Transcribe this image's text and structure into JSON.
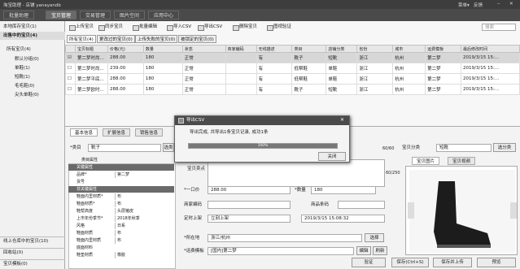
{
  "app": {
    "title": "淘宝助理 - 店铺 yanayandb",
    "menu": "菜单▾",
    "feedback": "反馈",
    "min": "‒",
    "close": "✕"
  },
  "nav": {
    "tabs": [
      "批量助理",
      "宝贝管理",
      "交易管理",
      "图片空间",
      "应用中心"
    ],
    "active": 1
  },
  "sidebar": {
    "top_items": [
      "本地库存宝贝(1)",
      "出售中的宝贝(4)"
    ],
    "tree": [
      {
        "label": "所有宝贝(4)"
      },
      {
        "label": "默认分组(0)"
      },
      {
        "label": "单鞋(1)"
      },
      {
        "label": "短靴(1)"
      },
      {
        "label": "毛毛鞋(0)"
      },
      {
        "label": "尖头单鞋(0)"
      }
    ],
    "bottom_items": [
      "线上仓库中的宝贝(10)",
      "回收站(0)",
      "宝贝模板(0)"
    ]
  },
  "toolbar": {
    "buttons": [
      "上传宝贝",
      "同步宝贝",
      "批量编辑",
      "导入CSV",
      "导出CSV",
      "删除宝贝",
      "图视验证"
    ],
    "search_placeholder": "搜索"
  },
  "filter_tabs": [
    "所有宝贝(4)",
    "更改过的宝贝(0)",
    "上传失败的宝贝(0)",
    "被锁定的宝贝(0)"
  ],
  "grid": {
    "headers": [
      "宝贝标题",
      "价格(元)",
      "数量",
      "状态",
      "商家编码",
      "无线描述",
      "类目",
      "店铺分类",
      "省份",
      "城市",
      "运费模板",
      "最后修改时间"
    ],
    "rows": [
      [
        "第二梦时尚...",
        "288.00",
        "180",
        "正常",
        "",
        "有",
        "靴子",
        "短靴",
        "浙江",
        "杭州",
        "第二梦",
        "2019/3/15 15:..."
      ],
      [
        "第二梦时尚...",
        "239.00",
        "180",
        "正常",
        "",
        "有",
        "低帮鞋",
        "单鞋",
        "浙江",
        "杭州",
        "第二梦",
        "2019/3/15 15:..."
      ],
      [
        "第二梦平底...",
        "288.00",
        "180",
        "正常",
        "",
        "有",
        "低帮鞋",
        "单鞋",
        "浙江",
        "杭州",
        "第二梦",
        "2019/3/15 15:..."
      ],
      [
        "第二梦欧时...",
        "288.00",
        "180",
        "正常",
        "",
        "有",
        "靴子",
        "短靴",
        "浙江",
        "杭州",
        "第二梦",
        "2019/3/15 15:..."
      ]
    ]
  },
  "detail": {
    "tabs": [
      "基本信息",
      "扩展信息",
      "销售信息"
    ],
    "category_label": "*类目",
    "category_value": "靴子",
    "category_btn": "选类",
    "props_header": "类目属性",
    "props": [
      [
        "关键属性",
        ""
      ],
      [
        "品牌*",
        "第二梦"
      ],
      [
        "货号",
        ""
      ],
      [
        "非关键属性",
        ""
      ],
      [
        "鞋面内里材质*",
        "布"
      ],
      [
        "鞋面材质*",
        "布"
      ],
      [
        "鞋帮高度",
        "头层猪皮"
      ],
      [
        "上市年份季节*",
        "2018年秋季"
      ],
      [
        "风格",
        "日系"
      ],
      [
        "鞋面材质",
        "布"
      ],
      [
        "鞋面内里材质",
        "布"
      ],
      [
        "底面材料",
        ""
      ],
      [
        "鞋垫材质",
        "橡胶"
      ]
    ],
    "title_label": "宝贝卖点",
    "counter": "60/250",
    "price_label": "*一口价",
    "price_value": "288.00",
    "qty_label": "*数量",
    "qty_value": "180",
    "code_label": "商家编码",
    "barcode_label": "商品条码",
    "onsale_label": "定时上架",
    "onsale_value": "立刻上架",
    "onsale_time": "2019/3/15 15:08:32",
    "location_label": "*所在地",
    "location_value": "浙江/杭州",
    "location_btn": "选择",
    "shipping_label": "*运费模板",
    "shipping_value": "[国内]第二梦",
    "shipping_btn1": "编辑",
    "shipping_btn2": "刷新",
    "shop_cat_label": "宝贝分类",
    "shop_cat_value": "短靴",
    "shop_cat_btn": "选分类",
    "title_counter": "60/60",
    "img_tabs": [
      "宝贝图片",
      "宝贝视频"
    ]
  },
  "footer": {
    "buttons": [
      "验证",
      "保存(Ctrl+S)",
      "保存并上传",
      "预览"
    ]
  },
  "dialog": {
    "title": "导出CSV",
    "message": "导出完成, 共导出1条宝贝记录, 成功1条",
    "progress": 100,
    "progress_label": "100%",
    "close_btn": "关闭"
  }
}
